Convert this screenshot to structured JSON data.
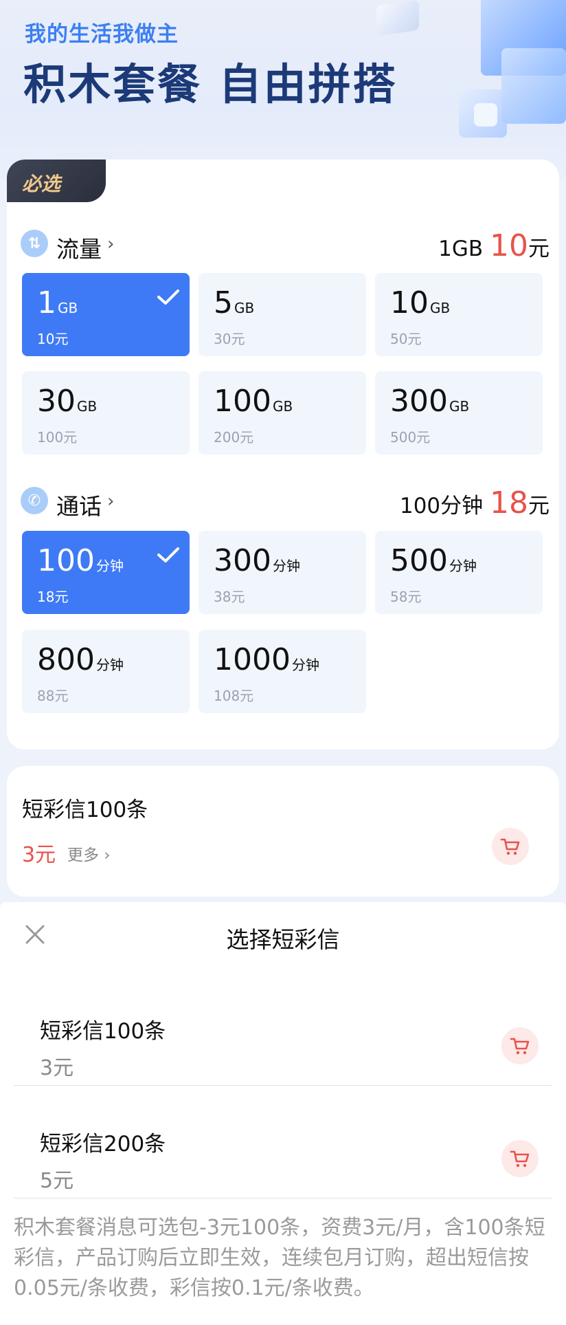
{
  "hero": {
    "slogan": "我的生活我做主",
    "headline": "积木套餐 自由拼搭"
  },
  "required": {
    "badge": "必选",
    "data_section": {
      "title": "流量",
      "summary_amount": "1GB ",
      "summary_price": "10",
      "summary_unit": "元",
      "options": [
        {
          "amount": "1",
          "unit": "GB",
          "price": "10元",
          "selected": true
        },
        {
          "amount": "5",
          "unit": "GB",
          "price": "30元",
          "selected": false
        },
        {
          "amount": "10",
          "unit": "GB",
          "price": "50元",
          "selected": false
        },
        {
          "amount": "30",
          "unit": "GB",
          "price": "100元",
          "selected": false
        },
        {
          "amount": "100",
          "unit": "GB",
          "price": "200元",
          "selected": false
        },
        {
          "amount": "300",
          "unit": "GB",
          "price": "500元",
          "selected": false
        }
      ]
    },
    "call_section": {
      "title": "通话",
      "summary_amount": "100分钟 ",
      "summary_price": "18",
      "summary_unit": "元",
      "options": [
        {
          "amount": "100",
          "unit": "分钟",
          "price": "18元",
          "selected": true
        },
        {
          "amount": "300",
          "unit": "分钟",
          "price": "38元",
          "selected": false
        },
        {
          "amount": "500",
          "unit": "分钟",
          "price": "58元",
          "selected": false
        },
        {
          "amount": "800",
          "unit": "分钟",
          "price": "88元",
          "selected": false
        },
        {
          "amount": "1000",
          "unit": "分钟",
          "price": "108元",
          "selected": false
        }
      ]
    }
  },
  "sms_card": {
    "name": "短彩信100条",
    "price": "3元",
    "more": "更多"
  },
  "sheet": {
    "title": "选择短彩信",
    "items": [
      {
        "name": "短彩信100条",
        "price": "3元"
      },
      {
        "name": "短彩信200条",
        "price": "5元"
      }
    ],
    "description": "积木套餐消息可选包-3元100条，资费3元/月，含100条短彩信，产品订购后立即生效，连续包月订购，超出短信按0.05元/条收费，彩信按0.1元/条收费。"
  },
  "colors": {
    "accent_blue": "#3f7af6",
    "price_red": "#e8534b",
    "badge_gold": "#f0c98c"
  },
  "icons": [
    "data-arrows-icon",
    "phone-icon",
    "chevron-right-icon",
    "checkmark-icon",
    "shopping-cart-icon",
    "close-icon"
  ]
}
